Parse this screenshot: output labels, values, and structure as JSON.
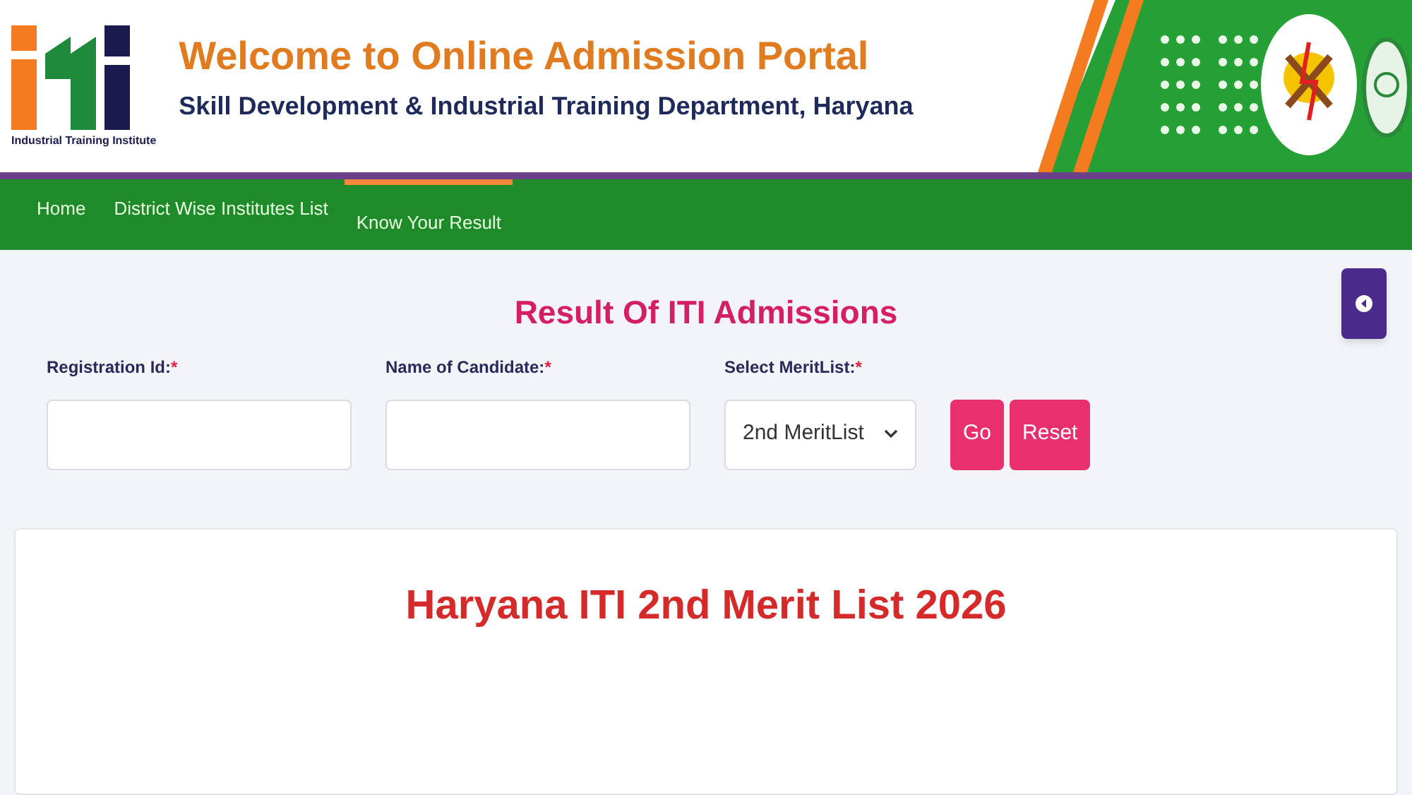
{
  "header": {
    "logo_caption": "Industrial Training Institute",
    "title": "Welcome to Online Admission Portal",
    "subtitle": "Skill Development & Industrial Training Department, Haryana"
  },
  "nav": [
    {
      "label": "Home",
      "selected": false
    },
    {
      "label": "District Wise Institutes List",
      "selected": false
    },
    {
      "label": "Know Your Result",
      "selected": true
    }
  ],
  "form": {
    "title": "Result Of ITI Admissions",
    "fields": [
      {
        "kind": "text",
        "label": "Registration Id:",
        "required_mark": "*"
      },
      {
        "kind": "text",
        "label": "Name of Candidate:",
        "required_mark": "*"
      },
      {
        "kind": "select",
        "label": "Select MeritList:",
        "required_mark": "*",
        "value": "2nd MeritList"
      }
    ],
    "buttons": [
      "Go",
      "Reset"
    ]
  },
  "result": {
    "title": "Haryana ITI 2nd Merit List 2026"
  }
}
